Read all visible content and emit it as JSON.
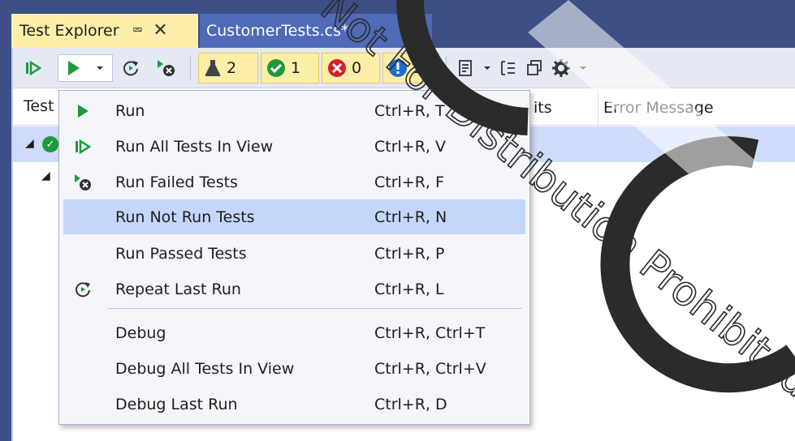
{
  "tabs": {
    "active_label": "Test Explorer",
    "doc_label": "CustomerTests.cs*"
  },
  "toolbar": {
    "counters": [
      {
        "icon": "flask-icon",
        "count": "2",
        "color": "#444444"
      },
      {
        "icon": "check-circle-icon",
        "count": "1",
        "color": "#1e9a3b"
      },
      {
        "icon": "x-circle-icon",
        "count": "0",
        "color": "#d71f2b"
      },
      {
        "icon": "info-circle-icon",
        "count": "1",
        "color": "#1c6fd0"
      }
    ]
  },
  "header": {
    "test_label": "Test",
    "traits_label": "its",
    "error_label": "Error Message"
  },
  "menu": {
    "items": [
      {
        "label": "Run",
        "shortcut": "Ctrl+R, T",
        "icon": "play-icon"
      },
      {
        "label": "Run All Tests In View",
        "shortcut": "Ctrl+R, V",
        "icon": "run-all-icon"
      },
      {
        "label": "Run Failed Tests",
        "shortcut": "Ctrl+R, F",
        "icon": "run-failed-icon"
      },
      {
        "label": "Run Not Run Tests",
        "shortcut": "Ctrl+R, N",
        "icon": ""
      },
      {
        "label": "Run Passed Tests",
        "shortcut": "Ctrl+R, P",
        "icon": ""
      },
      {
        "label": "Repeat Last Run",
        "shortcut": "Ctrl+R, L",
        "icon": "repeat-icon"
      },
      {
        "label": "Debug",
        "shortcut": "Ctrl+R, Ctrl+T",
        "icon": ""
      },
      {
        "label": "Debug All Tests In View",
        "shortcut": "Ctrl+R, Ctrl+V",
        "icon": ""
      },
      {
        "label": "Debug Last Run",
        "shortcut": "Ctrl+R, D",
        "icon": ""
      }
    ],
    "highlighted_index": 3
  },
  "watermark": {
    "text": "Not For Distribution Prohibited"
  },
  "colors": {
    "frame": "#3d4f84",
    "active_tab": "#fdefa7",
    "highlight": "#c5d6fb",
    "run_green": "#1e9a3b"
  }
}
